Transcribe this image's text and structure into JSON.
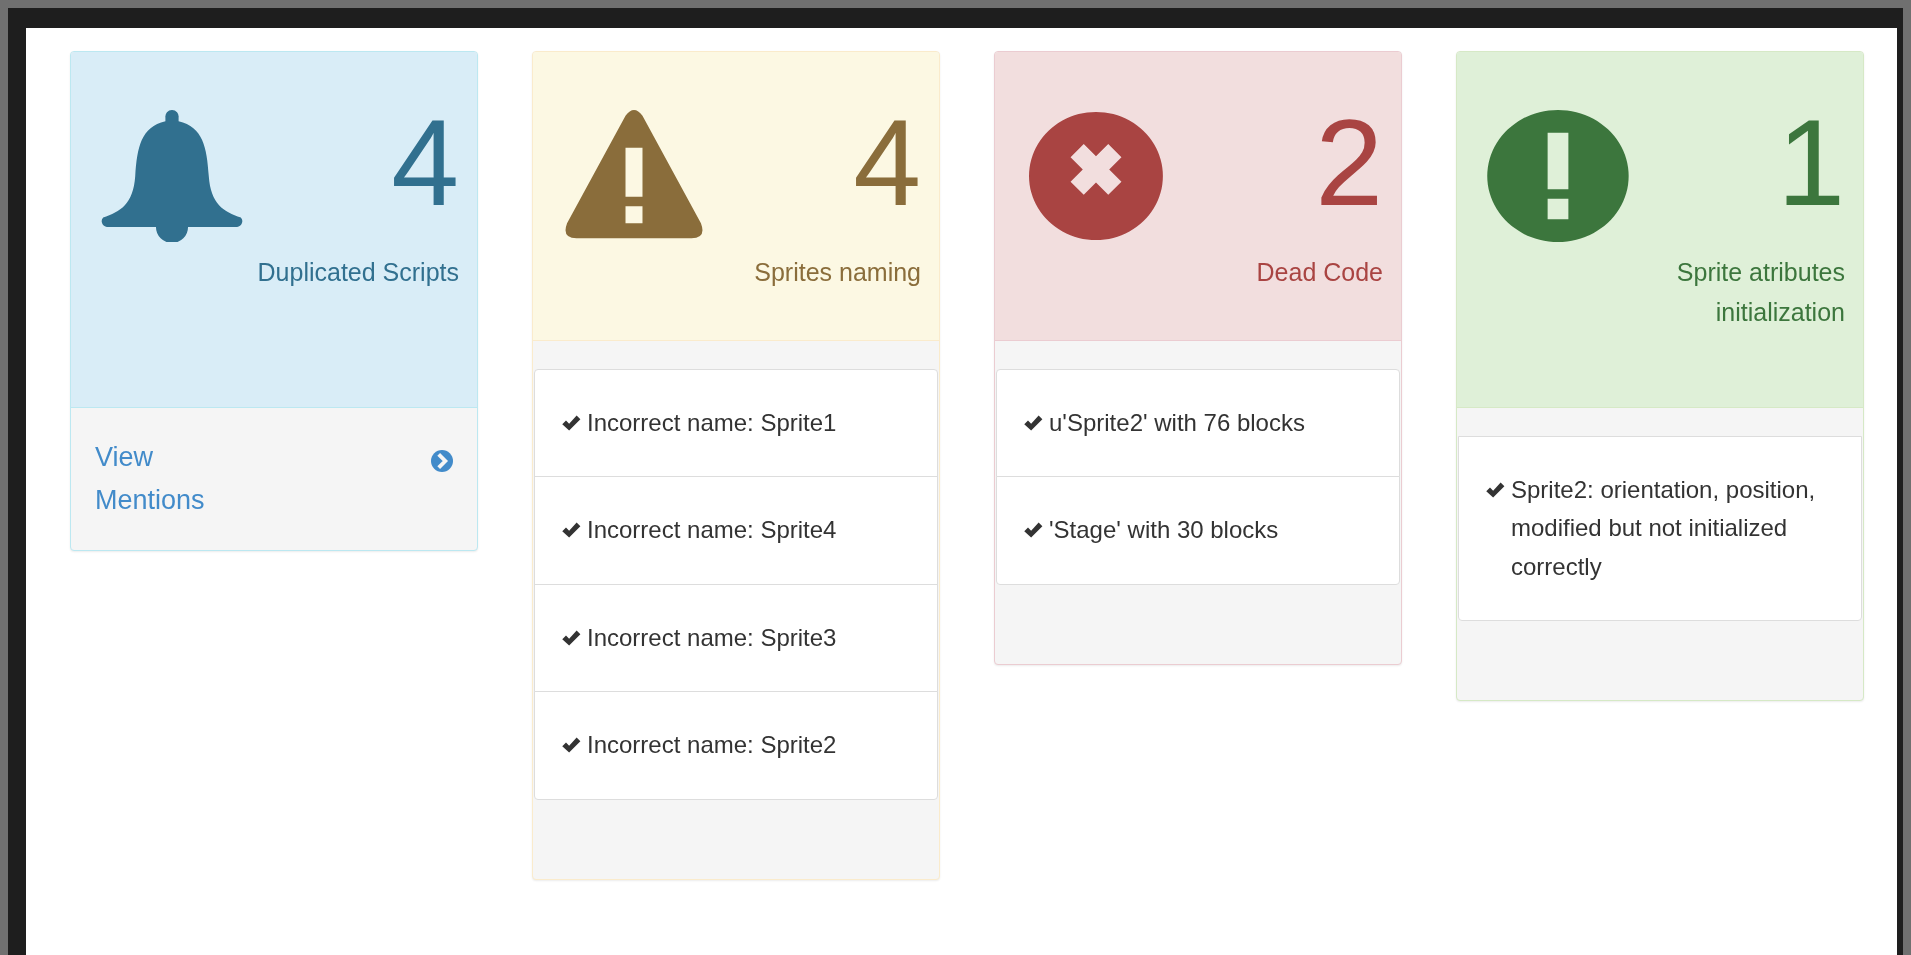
{
  "cards": [
    {
      "kind": "info",
      "count": "4",
      "label": "Duplicated Scripts",
      "link": "View Mentions"
    },
    {
      "kind": "warning",
      "count": "4",
      "label": "Sprites naming",
      "items": [
        "Incorrect name: Sprite1",
        "Incorrect name: Sprite4",
        "Incorrect name: Sprite3",
        "Incorrect name: Sprite2"
      ]
    },
    {
      "kind": "danger",
      "count": "2",
      "label": "Dead Code",
      "items": [
        "u'Sprite2' with 76 blocks",
        "'Stage' with 30 blocks"
      ]
    },
    {
      "kind": "success",
      "count": "1",
      "label": "Sprite atributes initialization",
      "items": [
        "Sprite2: orientation, position, modified but not initialized correctly"
      ]
    }
  ]
}
